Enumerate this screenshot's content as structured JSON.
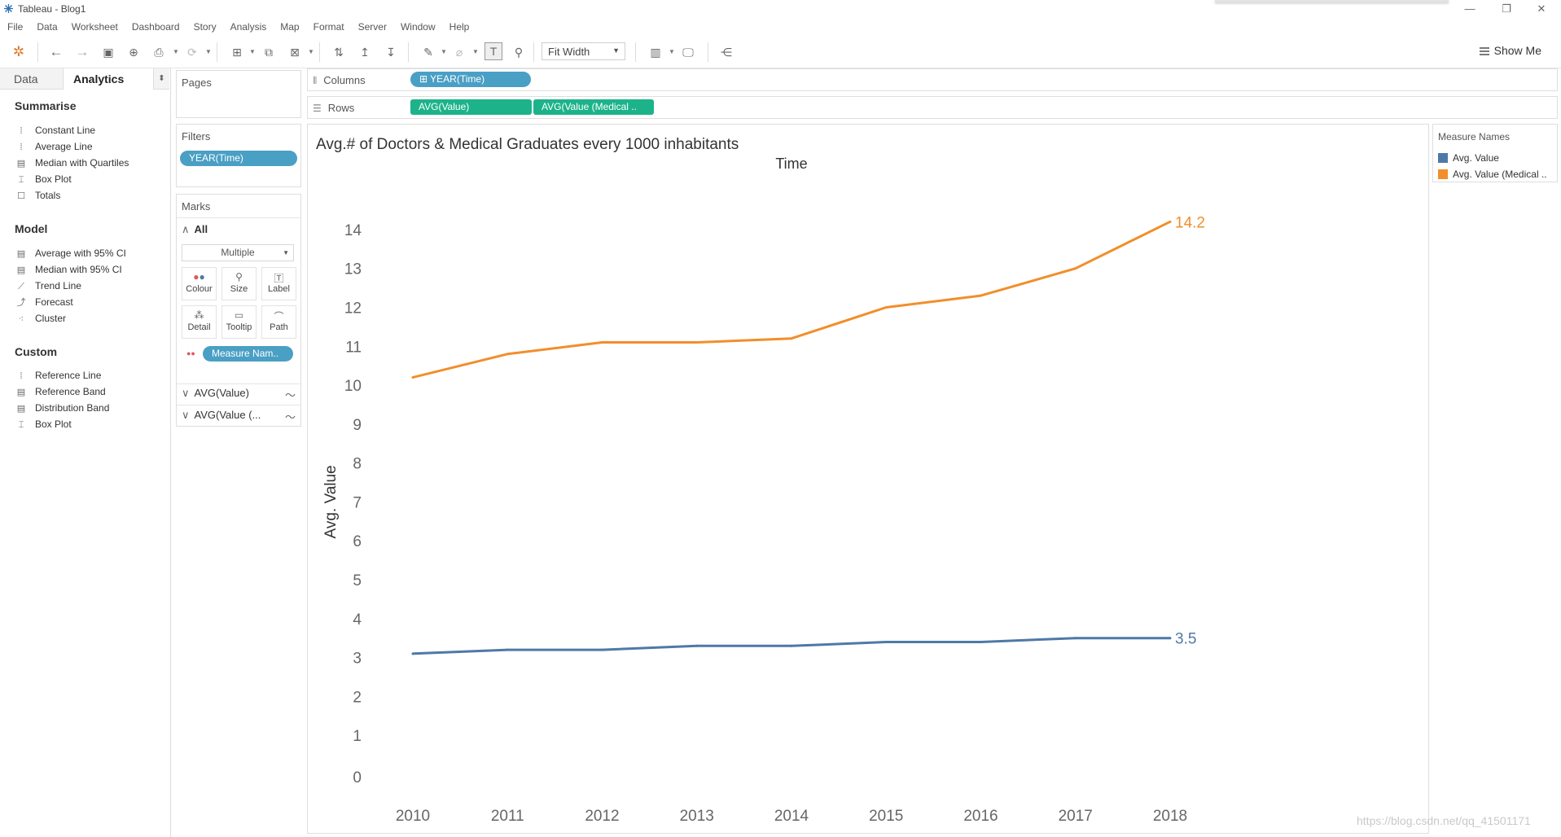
{
  "window": {
    "title": "Tableau - Blog1"
  },
  "menu": [
    "File",
    "Data",
    "Worksheet",
    "Dashboard",
    "Story",
    "Analysis",
    "Map",
    "Format",
    "Server",
    "Window",
    "Help"
  ],
  "toolbar": {
    "fit_label": "Fit Width",
    "show_me_label": "Show Me"
  },
  "left_pane": {
    "tabs": {
      "data": "Data",
      "analytics": "Analytics"
    },
    "summarise": {
      "heading": "Summarise",
      "items": [
        "Constant Line",
        "Average Line",
        "Median with Quartiles",
        "Box Plot",
        "Totals"
      ]
    },
    "model": {
      "heading": "Model",
      "items": [
        "Average with 95% CI",
        "Median with 95% CI",
        "Trend Line",
        "Forecast",
        "Cluster"
      ]
    },
    "custom": {
      "heading": "Custom",
      "items": [
        "Reference Line",
        "Reference Band",
        "Distribution Band",
        "Box Plot"
      ]
    }
  },
  "pages": {
    "title": "Pages"
  },
  "filters": {
    "title": "Filters",
    "pills": [
      "YEAR(Time)"
    ]
  },
  "marks": {
    "title": "Marks",
    "all_label": "All",
    "type": "Multiple",
    "buttons": {
      "colour": "Colour",
      "size": "Size",
      "label": "Label",
      "detail": "Detail",
      "tooltip": "Tooltip",
      "path": "Path"
    },
    "measure_pill": "Measure Nam..",
    "cards": [
      "AVG(Value)",
      "AVG(Value (..."
    ]
  },
  "shelves": {
    "columns": {
      "label": "Columns",
      "pills": [
        "YEAR(Time)"
      ]
    },
    "rows": {
      "label": "Rows",
      "pills": [
        "AVG(Value)",
        "AVG(Value (Medical .."
      ]
    }
  },
  "viz": {
    "title": "Avg.# of Doctors & Medical Graduates every 1000 inhabitants"
  },
  "legend": {
    "title": "Measure Names",
    "items": [
      {
        "label": "Avg. Value",
        "color": "#4e79a7"
      },
      {
        "label": "Avg. Value (Medical ..",
        "color": "#f28e2b"
      }
    ]
  },
  "chart_data": {
    "type": "line",
    "title": "Avg.# of Doctors & Medical Graduates every 1000 inhabitants",
    "xlabel": "Time",
    "ylabel": "Avg. Value",
    "x": [
      "2010",
      "2011",
      "2012",
      "2013",
      "2014",
      "2015",
      "2016",
      "2017",
      "2018"
    ],
    "y_ticks": [
      0,
      1,
      2,
      3,
      4,
      5,
      6,
      7,
      8,
      9,
      10,
      11,
      12,
      13,
      14
    ],
    "ylim": [
      0,
      14.5
    ],
    "grid": false,
    "legend_position": "right",
    "series": [
      {
        "name": "Avg. Value",
        "color": "#4e79a7",
        "values": [
          3.1,
          3.2,
          3.2,
          3.3,
          3.3,
          3.4,
          3.4,
          3.5,
          3.5
        ],
        "end_label": "3.5"
      },
      {
        "name": "Avg. Value (Medical ..",
        "color": "#f28e2b",
        "values": [
          10.2,
          10.8,
          11.1,
          11.1,
          11.2,
          12.0,
          12.3,
          13.0,
          14.2
        ],
        "end_label": "14.2"
      }
    ]
  },
  "watermark": "https://blog.csdn.net/qq_41501171"
}
